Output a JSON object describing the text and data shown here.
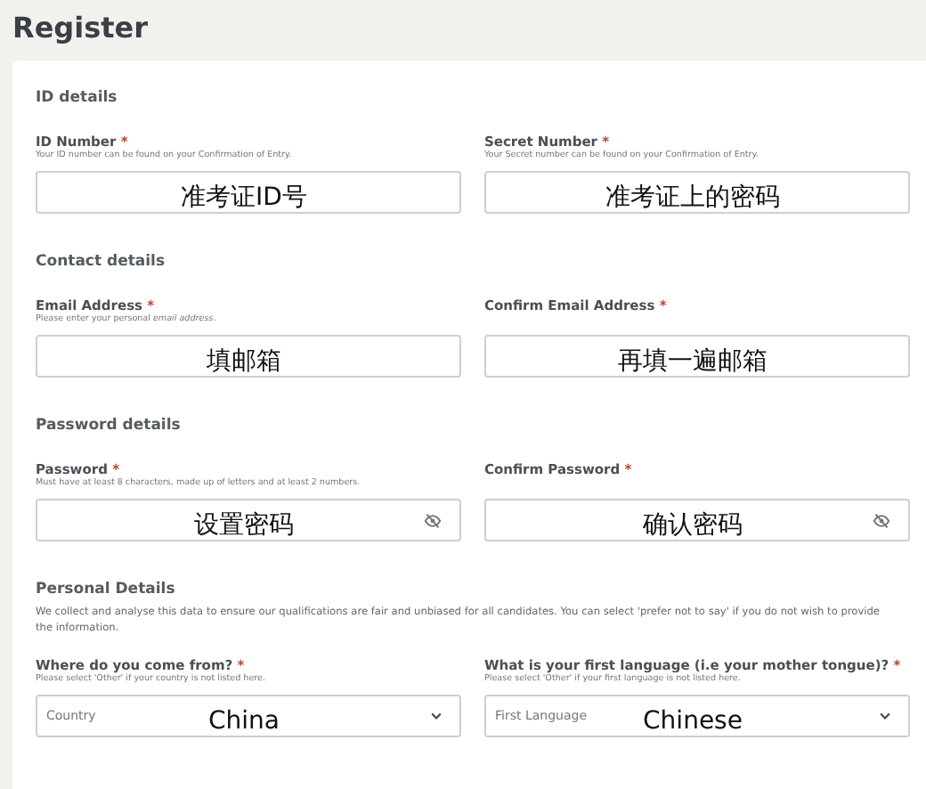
{
  "page": {
    "title": "Register"
  },
  "sections": [
    {
      "title": "ID details",
      "fields": [
        {
          "kind": "text",
          "label": "ID Number",
          "required_mark": "*",
          "hint": "Your ID number can be found on your Confirmation of Entry.",
          "annotation": "准考证ID号"
        },
        {
          "kind": "text",
          "label": "Secret Number",
          "required_mark": "*",
          "hint": "Your Secret number can be found on your Confirmation of Entry.",
          "annotation": "准考证上的密码"
        }
      ]
    },
    {
      "title": "Contact details",
      "fields": [
        {
          "kind": "text",
          "label": "Email Address",
          "required_mark": "*",
          "hint": "Please enter your personal *email address*.",
          "annotation": "填邮箱"
        },
        {
          "kind": "text",
          "label": "Confirm Email Address",
          "required_mark": "*",
          "annotation": "再填一遍邮箱"
        }
      ]
    },
    {
      "title": "Password details",
      "fields": [
        {
          "kind": "password",
          "label": "Password",
          "required_mark": "*",
          "hint": "Must have at least 8 characters, made up of letters and at least 2 numbers.",
          "annotation": "设置密码"
        },
        {
          "kind": "password",
          "label": "Confirm Password",
          "required_mark": "*",
          "annotation": "确认密码"
        }
      ]
    },
    {
      "title": "Personal Details",
      "description": "We collect and analyse this data to ensure our qualifications are fair and unbiased for all candidates. You can select 'prefer not to say' if you do not wish to provide the information.",
      "fields": [
        {
          "kind": "select",
          "label": "Where do you come from?",
          "required_mark": "*",
          "hint": "Please select 'Other' if your country is not listed here.",
          "placeholder": "Country",
          "annotation": "China"
        },
        {
          "kind": "select",
          "label": "What is your first language (i.e your mother tongue)?",
          "required_mark": "*",
          "hint": "Please select 'Other' if your first language is not listed here.",
          "placeholder": "First Language",
          "annotation": "Chinese"
        }
      ]
    }
  ]
}
